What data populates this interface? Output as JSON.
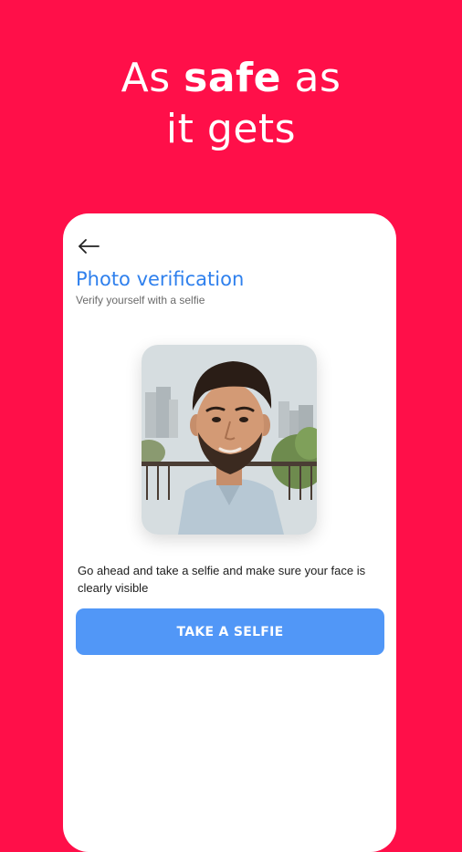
{
  "headline": {
    "line1_prefix": "As ",
    "line1_emphasis": "safe",
    "line1_suffix": " as",
    "line2": "it gets"
  },
  "screen": {
    "back_icon": "arrow-left-icon",
    "title": "Photo verification",
    "subtitle": "Verify yourself with a selfie",
    "instruction": "Go ahead and take a selfie and make sure your face is clearly visible",
    "button_label": "TAKE A SELFIE"
  },
  "colors": {
    "background": "#FF0F49",
    "card": "#FFFFFF",
    "title": "#2F80ED",
    "button": "#5197F7",
    "button_text": "#FFFFFF"
  }
}
